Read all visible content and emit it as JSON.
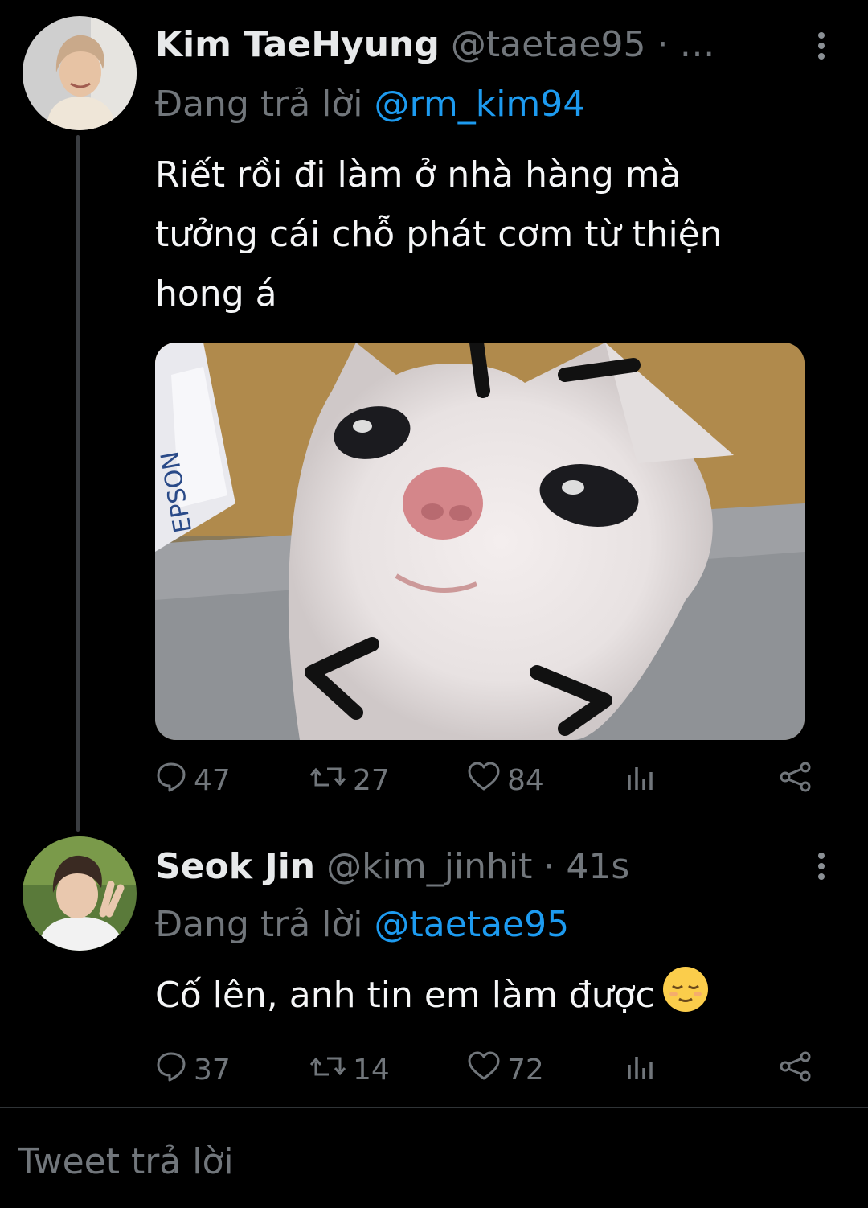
{
  "tweets": [
    {
      "name": "Kim TaeHyung",
      "handle": "@taetae95",
      "separator": "·",
      "time": "…",
      "replying_prefix": "Đang trả lời",
      "replying_to": "@rm_kim94",
      "text_lines": [
        "Riết rồi đi làm ở nhà hàng mà",
        "tưởng cái chỗ phát cơm từ thiện",
        "hong á"
      ],
      "media_caption": "EPSON",
      "stats": {
        "replies": "47",
        "retweets": "27",
        "likes": "84"
      }
    },
    {
      "name": "Seok Jin",
      "handle": "@kim_jinhit",
      "separator": "·",
      "time": "41s",
      "replying_prefix": "Đang trả lời",
      "replying_to": "@taetae95",
      "text": "Cố lên, anh tin em làm được",
      "stats": {
        "replies": "37",
        "retweets": "14",
        "likes": "72"
      }
    }
  ],
  "reply_bar": {
    "placeholder": "Tweet trả lời"
  },
  "colors": {
    "background": "#000000",
    "link": "#1d9bf0",
    "muted": "#71767b",
    "text": "#e7e9ea"
  },
  "icons": [
    "more-vertical-icon",
    "comment-icon",
    "retweet-icon",
    "heart-icon",
    "analytics-icon",
    "share-icon",
    "relieved-face-emoji"
  ]
}
